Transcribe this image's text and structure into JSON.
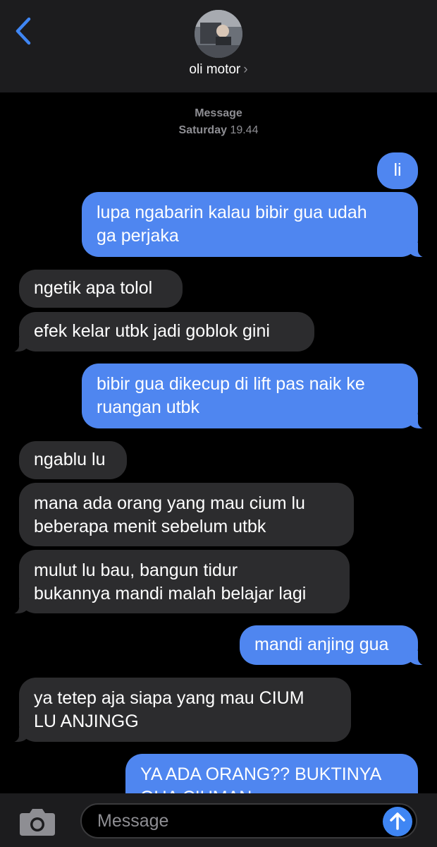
{
  "header": {
    "contact_name": "oli motor",
    "chevron": "›"
  },
  "thread_meta": {
    "service": "Message",
    "day": "Saturday",
    "time": "19.44"
  },
  "messages": [
    {
      "direction": "outgoing",
      "text": "li"
    },
    {
      "direction": "outgoing",
      "text": "lupa ngabarin kalau bibir gua udah\nga perjaka"
    },
    {
      "direction": "incoming",
      "text": "ngetik apa tolol"
    },
    {
      "direction": "incoming",
      "text": "efek kelar utbk jadi goblok gini"
    },
    {
      "direction": "outgoing",
      "text": "bibir gua dikecup di lift pas naik ke\nruangan utbk"
    },
    {
      "direction": "incoming",
      "text": "ngablu lu"
    },
    {
      "direction": "incoming",
      "text": "mana ada orang yang mau cium lu\nbeberapa menit sebelum utbk"
    },
    {
      "direction": "incoming",
      "text": "mulut lu bau, bangun tidur\nbukannya mandi malah belajar lagi"
    },
    {
      "direction": "outgoing",
      "text": "mandi anjing gua"
    },
    {
      "direction": "incoming",
      "text": "ya tetep aja siapa yang mau CIUM\nLU ANJINGG"
    },
    {
      "direction": "outgoing",
      "text": "YA ADA ORANG?? BUKTINYA\nGUA CIUMAN"
    }
  ],
  "composer": {
    "placeholder": "Message"
  },
  "icons": {
    "back": "chevron-left-icon",
    "camera": "camera-icon",
    "send": "arrow-up-icon"
  },
  "colors": {
    "outgoing_bubble": "#4f86f0",
    "incoming_bubble": "#2c2c2e",
    "accent": "#3f86f4"
  }
}
